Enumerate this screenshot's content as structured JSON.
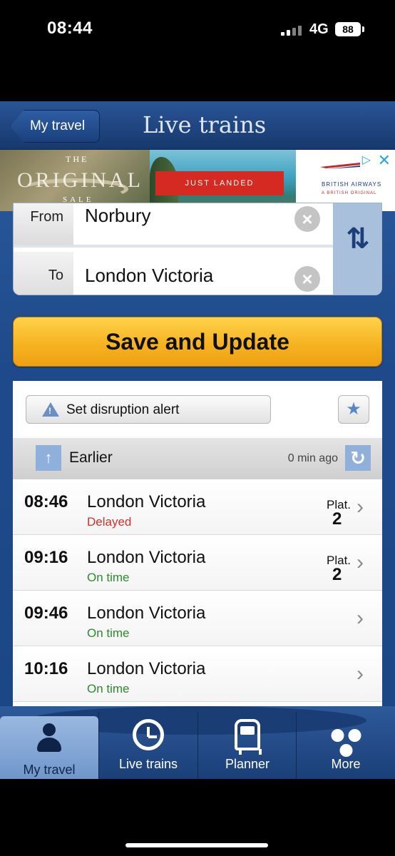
{
  "status": {
    "time": "08:44",
    "network": "4G",
    "battery": "88"
  },
  "navbar": {
    "back_label": "My travel",
    "title": "Live trains"
  },
  "ad": {
    "headline_the": "THE",
    "headline_main": "ORIGINAL",
    "headline_sale": "SALE",
    "cta": "JUST LANDED",
    "brand": "BRITISH AIRWAYS",
    "tagline": "A BRITISH ORIGINAL"
  },
  "route": {
    "from_label": "From",
    "from_value": "Norbury",
    "to_label": "To",
    "to_value": "London Victoria"
  },
  "save_label": "Save and Update",
  "alert_label": "Set disruption alert",
  "earlier": {
    "label": "Earlier",
    "updated": "0 min ago"
  },
  "trains": [
    {
      "time": "08:46",
      "destination": "London Victoria",
      "status": "Delayed",
      "platform_label": "Plat.",
      "platform": "2"
    },
    {
      "time": "09:16",
      "destination": "London Victoria",
      "status": "On time",
      "platform_label": "Plat.",
      "platform": "2"
    },
    {
      "time": "09:46",
      "destination": "London Victoria",
      "status": "On time"
    },
    {
      "time": "10:16",
      "destination": "London Victoria",
      "status": "On time"
    }
  ],
  "tabs": [
    {
      "label": "My travel",
      "icon": "person-icon"
    },
    {
      "label": "Live trains",
      "icon": "clock-icon"
    },
    {
      "label": "Planner",
      "icon": "train-icon"
    },
    {
      "label": "More",
      "icon": "more-dots-icon"
    }
  ],
  "colors": {
    "brand_blue": "#1e4a8c",
    "save_yellow": "#f6b322",
    "delayed": "#d0312d",
    "on_time": "#2d8a2d"
  }
}
